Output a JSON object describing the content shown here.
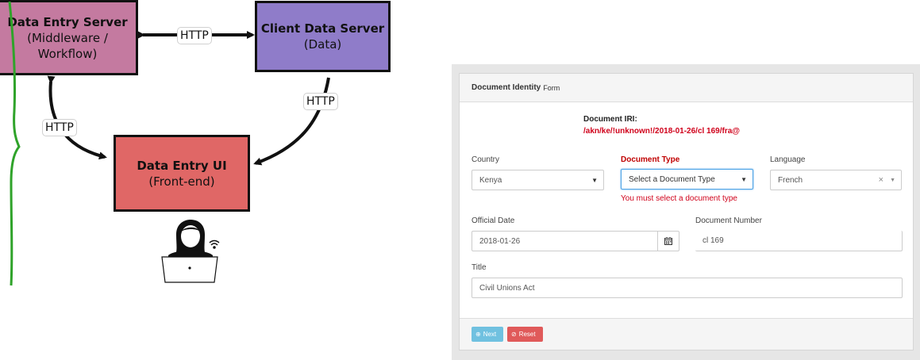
{
  "diagram": {
    "entry_server": {
      "title": "Data Entry Server",
      "sub1": "(Middleware /",
      "sub2": "Workflow)",
      "color": "#c47aa0"
    },
    "client_server": {
      "title": "Client Data Server",
      "sub": "(Data)",
      "color": "#8f7cc9"
    },
    "entry_ui": {
      "title": "Data Entry UI",
      "sub": "(Front-end)",
      "color": "#e06766"
    },
    "http_label": "HTTP",
    "user_icon": "person-at-laptop-icon",
    "wifi_icon": "wifi-icon"
  },
  "form": {
    "header_title": "Document Identity",
    "header_sub": "Form",
    "iri_label": "Document IRI:",
    "iri_value": "/akn/ke/!unknown!/2018-01-26/cl 169/fra@",
    "country": {
      "label": "Country",
      "value": "Kenya"
    },
    "doc_type": {
      "label": "Document Type",
      "value": "Select a Document Type",
      "error": "You must select a document type"
    },
    "language": {
      "label": "Language",
      "value": "French",
      "clear": "×"
    },
    "official_date": {
      "label": "Official Date",
      "value": "2018-01-26"
    },
    "doc_number": {
      "label": "Document Number",
      "value": "cl 169"
    },
    "title": {
      "label": "Title",
      "value": "Civil Unions Act"
    },
    "next_label": "Next",
    "reset_label": "Reset",
    "colors": {
      "error": "#d0021b",
      "next": "#70c1e0",
      "reset": "#e05a5a",
      "focus": "#4da3e6"
    }
  }
}
